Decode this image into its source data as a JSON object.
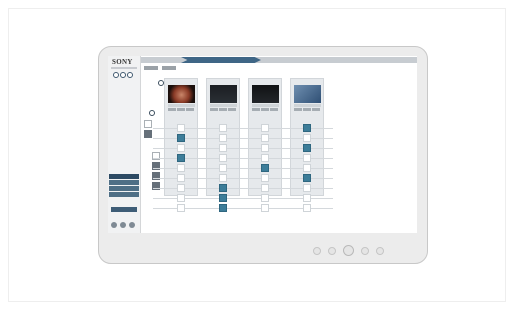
{
  "app": {
    "brand": "SONY"
  },
  "sidebar": {
    "items": [
      {
        "label": "",
        "head": true
      },
      {
        "label": "",
        "head": false
      },
      {
        "label": "",
        "head": false
      },
      {
        "label": "",
        "head": false
      },
      {
        "label": "",
        "head": false
      },
      {
        "label": "",
        "head": true
      },
      {
        "label": "",
        "head": false
      },
      {
        "label": "",
        "head": false
      },
      {
        "label": "",
        "head": false
      },
      {
        "label": "",
        "head": false
      },
      {
        "label": "",
        "head": false
      }
    ],
    "tabs": [
      {
        "label": "",
        "active": true
      },
      {
        "label": "",
        "active": false
      },
      {
        "label": "",
        "active": false
      },
      {
        "label": "",
        "active": false
      }
    ],
    "action_label": ""
  },
  "breadcrumb": {
    "steps": [
      "",
      "",
      ""
    ],
    "active_index": 0
  },
  "colors": {
    "accent": "#3d7d99",
    "nav_dark": "#2d4a63",
    "breadcrumb_active": "#3f6686"
  },
  "columns": [
    {
      "title": "",
      "thumb": "endoscope-red"
    },
    {
      "title": "",
      "thumb": "monitor-dark"
    },
    {
      "title": "",
      "thumb": "vitals-dark"
    },
    {
      "title": "",
      "thumb": "ceiling-camera-blue"
    }
  ],
  "routing": {
    "rows": 9,
    "active": [
      [
        0,
        3
      ],
      [
        1,
        0
      ],
      [
        2,
        3
      ],
      [
        3,
        0
      ],
      [
        4,
        2
      ],
      [
        5,
        3
      ],
      [
        6,
        1
      ],
      [
        7,
        1
      ],
      [
        8,
        1
      ]
    ]
  }
}
